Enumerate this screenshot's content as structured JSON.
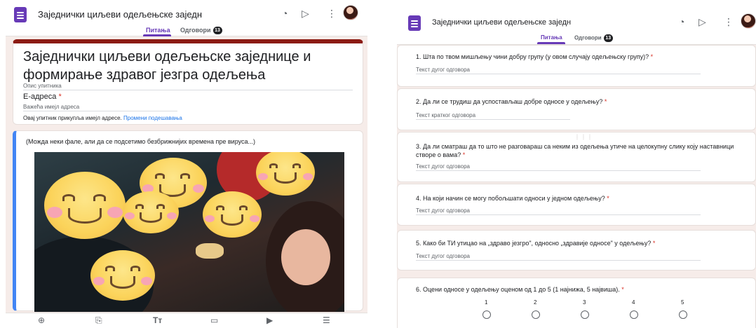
{
  "left": {
    "app_title": "Заједнички циљеви одељењске заједн",
    "tabs": [
      {
        "label": "Питања",
        "active": true
      },
      {
        "label": "Одговори",
        "badge": "13",
        "active": false
      }
    ],
    "form_title": "Заједнички циљеви одељењске заједнице и формирање здравог језгра одељења",
    "description_placeholder": "Опис упитника",
    "email_label": "Е-адреса",
    "required_mark": "*",
    "email_placeholder": "Важећа имејл адреса",
    "email_notice": "Овај упитник прикупља имејл адресе.",
    "email_notice_link": "Промени подешавања",
    "image_caption": "(Можда неки фале, али да се подсетимо безбрижнијих времена пре вируса...)",
    "bottom_tools": [
      "add-question-icon",
      "import-icon",
      "title-text-icon",
      "add-image-icon",
      "add-video-icon",
      "add-section-icon"
    ],
    "bottom_tool_glyphs": [
      "⊕",
      "⎘",
      "Tт",
      "▭",
      "▶",
      "☰"
    ]
  },
  "right": {
    "app_title": "Заједнички циљеви одељењске заједн",
    "tabs": [
      {
        "label": "Питања",
        "active": true
      },
      {
        "label": "Одговори",
        "badge": "13",
        "active": false
      }
    ],
    "questions": [
      {
        "text": "1. Шта по твом мишљењу чини добру групу (у овом случају одељењску групу)?",
        "answer": "Текст дугог одговора"
      },
      {
        "text": "2. Да ли се трудиш да успостављаш добре односе у одељењу?",
        "answer": "Текст кратког одговора"
      },
      {
        "text": "3. Да ли сматраш да то што не разговараш са неким из одељења утиче на целокупну слику коју наставници створе о вама?",
        "answer": "Текст дугог одговора"
      },
      {
        "text": "4. На који начин се могу побољшати односи у једном одељењу?",
        "answer": "Текст дугог одговора"
      },
      {
        "text": "5. Како би ТИ утицао на „здраво језгро\", односно „здравије односе\" у одељењу?",
        "answer": "Текст дугог одговора"
      },
      {
        "text": "6. Оцени односе у одељењу оценом од 1 до 5 (1 најнижа, 5 највиша).",
        "answer": ""
      }
    ],
    "required_mark": "*",
    "scale": [
      "1",
      "2",
      "3",
      "4",
      "5"
    ],
    "drag_handle": "⋮⋮⋮"
  },
  "icons": {
    "palette": "🎨",
    "send": "▷",
    "more": "⋮"
  },
  "colors": {
    "accent": "#673ab7",
    "header_border": "#8c1b13",
    "active_border": "#4285f4",
    "background": "#f6ece9"
  }
}
